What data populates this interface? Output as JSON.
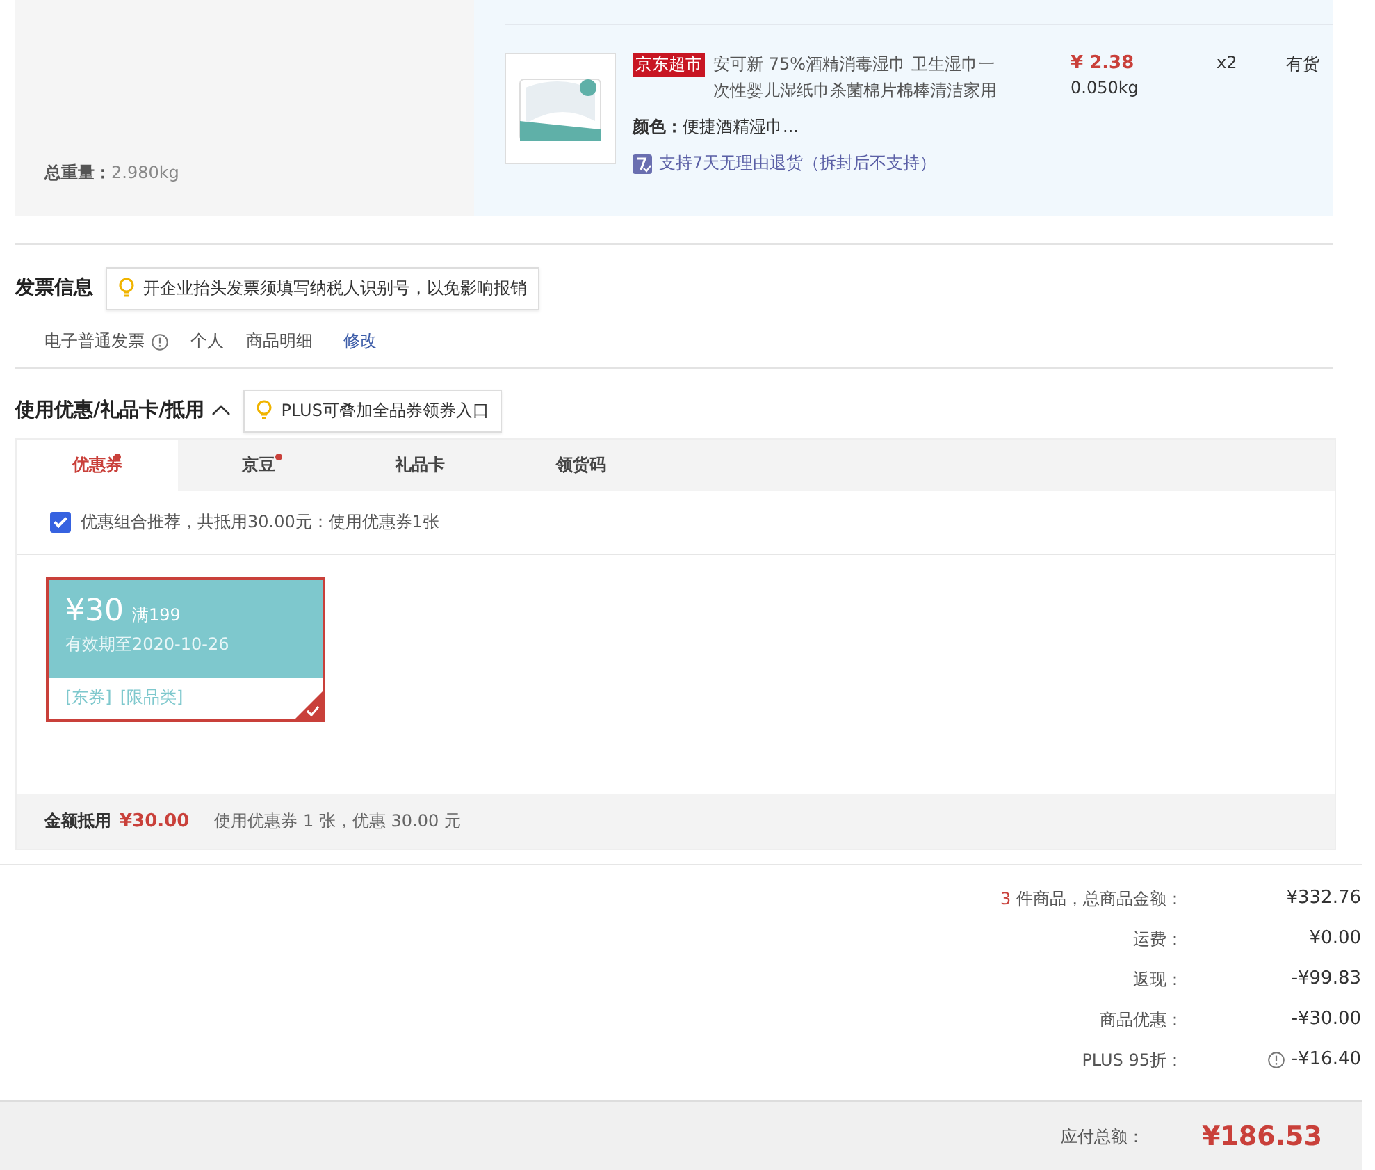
{
  "order": {
    "weight_label": "总重量：",
    "weight": "2.980kg",
    "item": {
      "shop_tag": "京东超市",
      "name": "安可新 75%酒精消毒湿巾 卫生湿巾一次性婴儿湿纸巾杀菌棉片棉棒清洁家用",
      "price": "¥ 2.38",
      "weight": "0.050kg",
      "spec_label": "颜色：",
      "spec": "便捷酒精湿巾...",
      "return_note": "支持7天无理由退货（拆封后不支持）",
      "quantity": "x2",
      "stock": "有货"
    }
  },
  "invoice": {
    "title": "发票信息",
    "tip": "开企业抬头发票须填写纳税人识别号，以免影响报销",
    "type": "电子普通发票",
    "fields": [
      "个人",
      "商品明细"
    ],
    "edit_link": "修改"
  },
  "discount": {
    "title": "使用优惠/礼品卡/抵用",
    "expanded": true,
    "tip": "PLUS可叠加全品券领券入口",
    "tabs": [
      {
        "label": "优惠券",
        "selected": true,
        "badge": true
      },
      {
        "label": "京豆",
        "selected": false,
        "badge": true
      },
      {
        "label": "礼品卡",
        "selected": false,
        "badge": false
      },
      {
        "label": "领货码",
        "selected": false,
        "badge": false
      }
    ],
    "recommend": {
      "checked": true,
      "text": "优惠组合推荐，共抵用30.00元：使用优惠券1张"
    },
    "coupons": [
      {
        "amount": "¥30",
        "threshold": "满199",
        "validity": "有效期至2020-10-26",
        "tags": [
          "[东券]",
          "[限品类]"
        ],
        "selected": true
      }
    ],
    "summary_label": "金额抵用",
    "summary_amount": "¥30.00",
    "summary_note": "使用优惠券 1 张，优惠 30.00 元"
  },
  "totals": {
    "rows": [
      {
        "count": "3",
        "label": " 件商品，总商品金额：",
        "value": "¥332.76",
        "info": false
      },
      {
        "label": "运费：",
        "value": "¥0.00",
        "info": false
      },
      {
        "label": "返现：",
        "value": "-¥99.83",
        "info": false
      },
      {
        "label": "商品优惠：",
        "value": "-¥30.00",
        "info": false
      },
      {
        "label": "PLUS 95折：",
        "value": "-¥16.40",
        "info": true
      }
    ],
    "payable_label": "应付总额：",
    "payable": "¥186.53"
  }
}
